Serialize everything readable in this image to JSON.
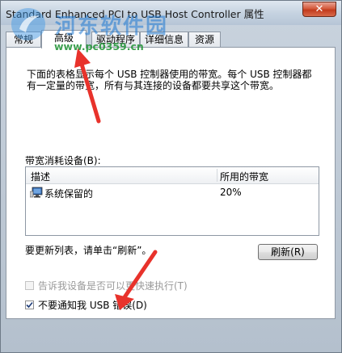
{
  "window": {
    "title": "Standard Enhanced PCI to USB Host Controller 属性",
    "close_label": "✕"
  },
  "tabs": [
    {
      "label": "常规"
    },
    {
      "label": "高级"
    },
    {
      "label": "驱动程序"
    },
    {
      "label": "详细信息"
    },
    {
      "label": "资源"
    }
  ],
  "advanced": {
    "description": "下面的表格显示每个 USB 控制器使用的带宽。每个 USB 控制器都有一定量的带宽，所有与其连接的设备都要共享这个带宽。",
    "bandwidth_label": "带宽消耗设备(B):",
    "columns": [
      "描述",
      "所用的带宽"
    ],
    "rows": [
      {
        "device": "系统保留的",
        "bandwidth": "20%"
      }
    ],
    "refresh_hint": "要更新列表，请单击“刷新”。",
    "refresh_button": "刷新(R)",
    "option_fast": {
      "label": "告诉我设备是否可以更快速执行(T)",
      "checked": false,
      "enabled": false
    },
    "option_no_notify": {
      "label": "不要通知我 USB 错误(D)",
      "checked": true,
      "enabled": true
    }
  },
  "watermark": {
    "site_name": "河东软件园",
    "url": "www.pc0359.cn"
  },
  "colors": {
    "annotation_arrow": "#e8322b"
  }
}
